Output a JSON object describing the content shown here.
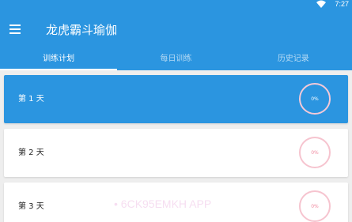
{
  "status_bar": {
    "time": "7:27"
  },
  "app_bar": {
    "title": "龙虎霸斗瑜伽"
  },
  "tabs": [
    {
      "label": "训练计划",
      "active": true
    },
    {
      "label": "每日训练",
      "active": false
    },
    {
      "label": "历史记录",
      "active": false
    }
  ],
  "plan_days": [
    {
      "label": "第 1 天",
      "progress": "0%",
      "selected": true
    },
    {
      "label": "第 2 天",
      "progress": "0%",
      "selected": false
    },
    {
      "label": "第 3 天",
      "progress": "0%",
      "selected": false
    }
  ],
  "watermark": "• 6CK95EMKH APP",
  "colors": {
    "primary": "#2b95e0",
    "ring": "#f6c4cf",
    "background": "#eeeeee"
  },
  "icons": {
    "menu": "menu-icon",
    "wifi": "wifi-icon"
  }
}
